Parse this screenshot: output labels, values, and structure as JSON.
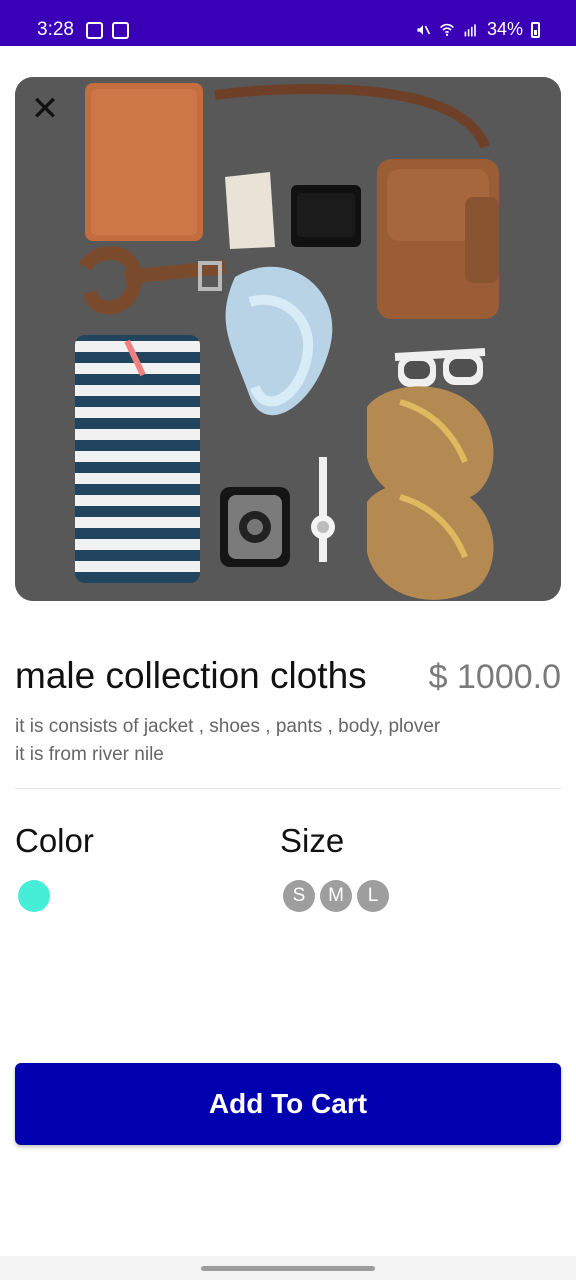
{
  "status": {
    "time": "3:28",
    "battery": "34%"
  },
  "product": {
    "title": "male collection cloths",
    "price": "$ 1000.0",
    "description_lines": [
      "it is consists of jacket , shoes , pants , body, plover",
      "it is from river nile"
    ]
  },
  "options": {
    "color_label": "Color",
    "size_label": "Size",
    "sizes": [
      "S",
      "M",
      "L"
    ]
  },
  "actions": {
    "add_to_cart": "Add To Cart"
  },
  "colors": {
    "status_bar": "#3a00b8",
    "cta": "#0000ae",
    "swatch": "#47eed7",
    "price": "#7a7a7a"
  },
  "icons": {
    "close": "close-icon",
    "status_right": [
      "mute-icon",
      "wifi-icon",
      "signal-icon",
      "battery-icon"
    ],
    "status_left": [
      "notification-icon",
      "gallery-icon"
    ]
  }
}
